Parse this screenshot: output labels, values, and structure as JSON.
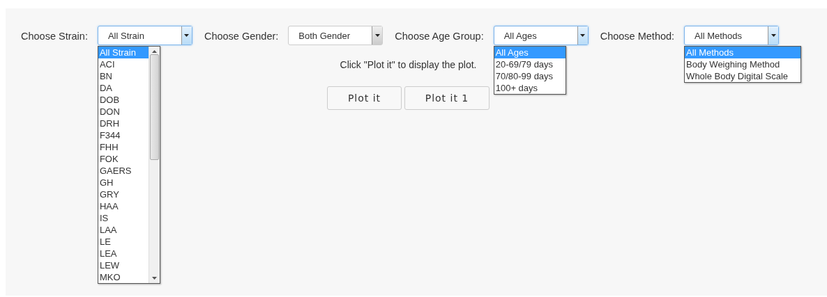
{
  "filters": [
    {
      "label": "Choose Strain:",
      "value": "All Strain",
      "open": true,
      "options": [
        {
          "label": "All Strain",
          "selected": true
        },
        {
          "label": "ACI",
          "selected": false
        },
        {
          "label": "BN",
          "selected": false
        },
        {
          "label": "DA",
          "selected": false
        },
        {
          "label": "DOB",
          "selected": false
        },
        {
          "label": "DON",
          "selected": false
        },
        {
          "label": "DRH",
          "selected": false
        },
        {
          "label": "F344",
          "selected": false
        },
        {
          "label": "FHH",
          "selected": false
        },
        {
          "label": "FOK",
          "selected": false
        },
        {
          "label": "GAERS",
          "selected": false
        },
        {
          "label": "GH",
          "selected": false
        },
        {
          "label": "GRY",
          "selected": false
        },
        {
          "label": "HAA",
          "selected": false
        },
        {
          "label": "IS",
          "selected": false
        },
        {
          "label": "LAA",
          "selected": false
        },
        {
          "label": "LE",
          "selected": false
        },
        {
          "label": "LEA",
          "selected": false
        },
        {
          "label": "LEW",
          "selected": false
        },
        {
          "label": "MKO",
          "selected": false
        }
      ]
    },
    {
      "label": "Choose Gender:",
      "value": "Both Gender",
      "open": false
    },
    {
      "label": "Choose Age Group:",
      "value": "All Ages",
      "open": true,
      "options": [
        {
          "label": "All Ages",
          "selected": true
        },
        {
          "label": "20-69/79 days",
          "selected": false
        },
        {
          "label": "70/80-99 days",
          "selected": false
        },
        {
          "label": "100+ days",
          "selected": false
        }
      ]
    },
    {
      "label": "Choose Method:",
      "value": "All Methods",
      "open": true,
      "options": [
        {
          "label": "All Methods",
          "selected": true
        },
        {
          "label": "Body Weighing Method",
          "selected": false
        },
        {
          "label": "Whole Body Digital Scale",
          "selected": false
        }
      ]
    }
  ],
  "message": "Click \"Plot it\" to display the plot.",
  "buttons": [
    "Plot it",
    "Plot it 1"
  ]
}
